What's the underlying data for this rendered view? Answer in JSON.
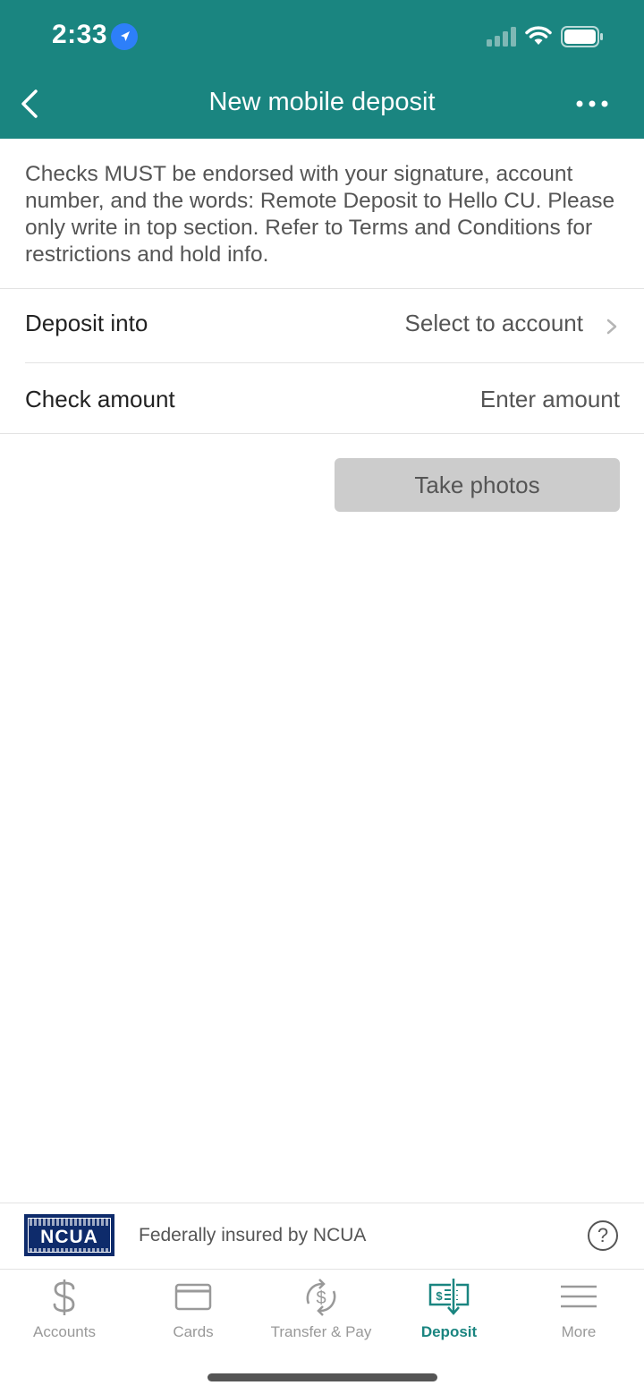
{
  "status_bar": {
    "time": "2:33"
  },
  "header": {
    "title": "New mobile deposit"
  },
  "notice": "Checks MUST be endorsed with your signature, account number, and the words: Remote Deposit to Hello CU. Please only write in top section. Refer to Terms and Conditions for restrictions and hold info.",
  "deposit_into": {
    "label": "Deposit into",
    "value": "Select to account"
  },
  "check_amount": {
    "label": "Check amount",
    "placeholder": "Enter amount"
  },
  "take_photos_label": "Take photos",
  "footer": {
    "logo_text": "NCUA",
    "label": "Federally insured by NCUA",
    "help": "?"
  },
  "tabs": [
    {
      "label": "Accounts",
      "icon": "dollar-icon"
    },
    {
      "label": "Cards",
      "icon": "card-icon"
    },
    {
      "label": "Transfer & Pay",
      "icon": "transfer-icon"
    },
    {
      "label": "Deposit",
      "icon": "check-deposit-icon",
      "active": true
    },
    {
      "label": "More",
      "icon": "menu-icon"
    }
  ],
  "colors": {
    "brand": "#1a8580",
    "disabled_button": "#cccccc",
    "ncua_blue": "#0e2b6b"
  }
}
